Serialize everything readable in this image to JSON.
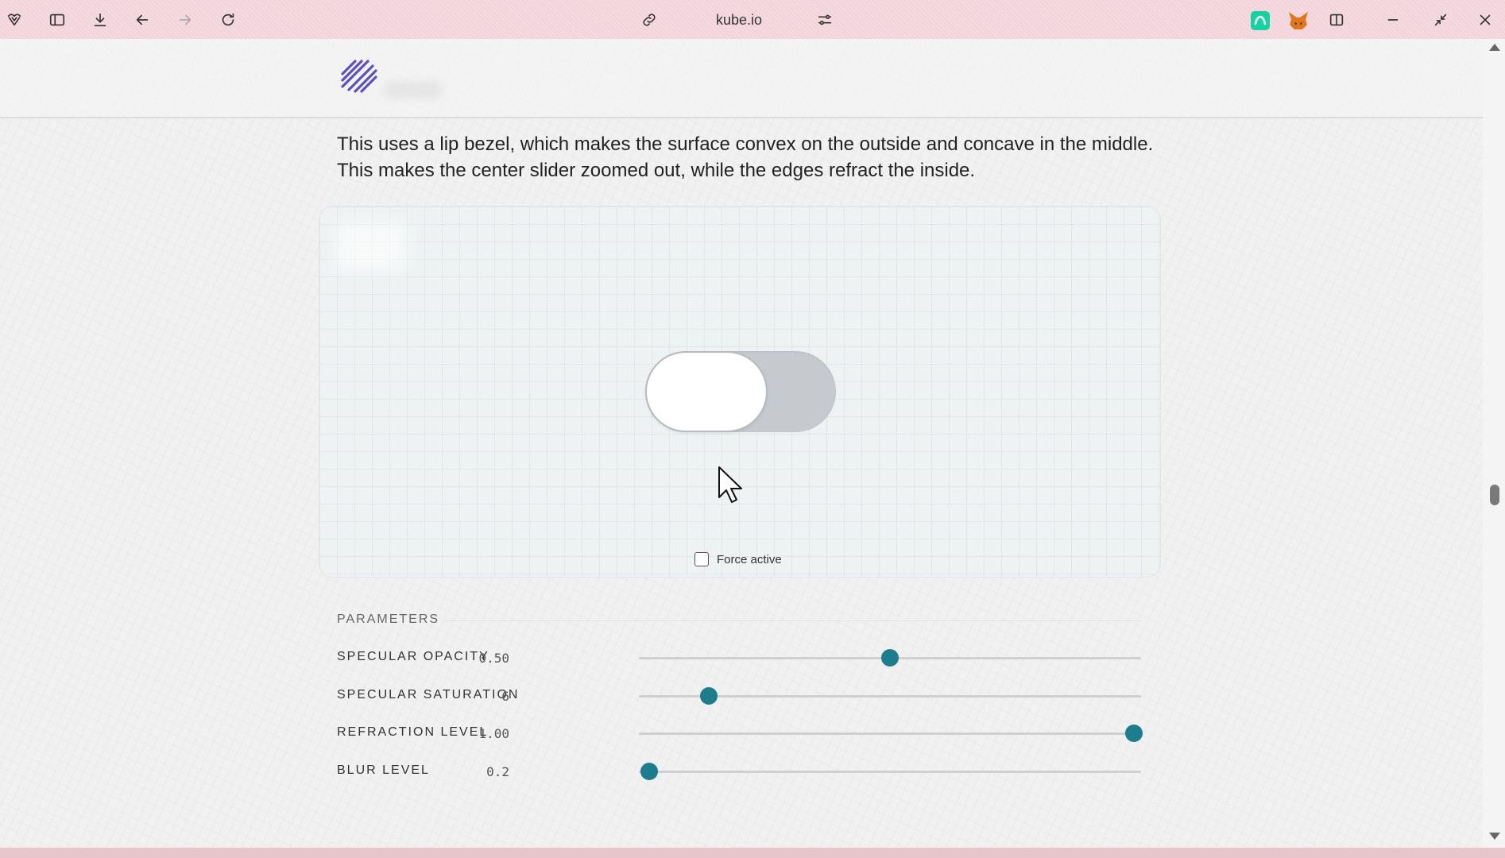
{
  "browser": {
    "url": "kube.io",
    "colors": {
      "chrome": "#f2d3da"
    },
    "icons": [
      "vivaldi-logo-icon",
      "sidebar-panel-icon",
      "download-icon",
      "back-arrow-icon",
      "forward-arrow-icon",
      "reload-icon",
      "link-icon",
      "page-settings-icon",
      "green-extension-icon",
      "fox-extension-icon",
      "split-view-icon",
      "minimize-icon",
      "restore-icon",
      "close-icon"
    ]
  },
  "site": {
    "intro": "This uses a lip bezel, which makes the surface convex on the outside and concave in the middle. This makes the center slider zoomed out, while the edges refract the inside."
  },
  "demo": {
    "toggle_on": false,
    "force_active_label": "Force active",
    "force_active_checked": false
  },
  "parameters": {
    "title": "PARAMETERS",
    "accent_color": "#1d7d8c",
    "items": [
      {
        "label": "SPECULAR OPACITY",
        "value": "0.50",
        "fraction": 0.5
      },
      {
        "label": "SPECULAR SATURATION",
        "value": "6",
        "fraction": 0.14
      },
      {
        "label": "REFRACTION LEVEL",
        "value": "1.00",
        "fraction": 0.985
      },
      {
        "label": "BLUR LEVEL",
        "value": "0.2",
        "fraction": 0.02
      }
    ]
  }
}
